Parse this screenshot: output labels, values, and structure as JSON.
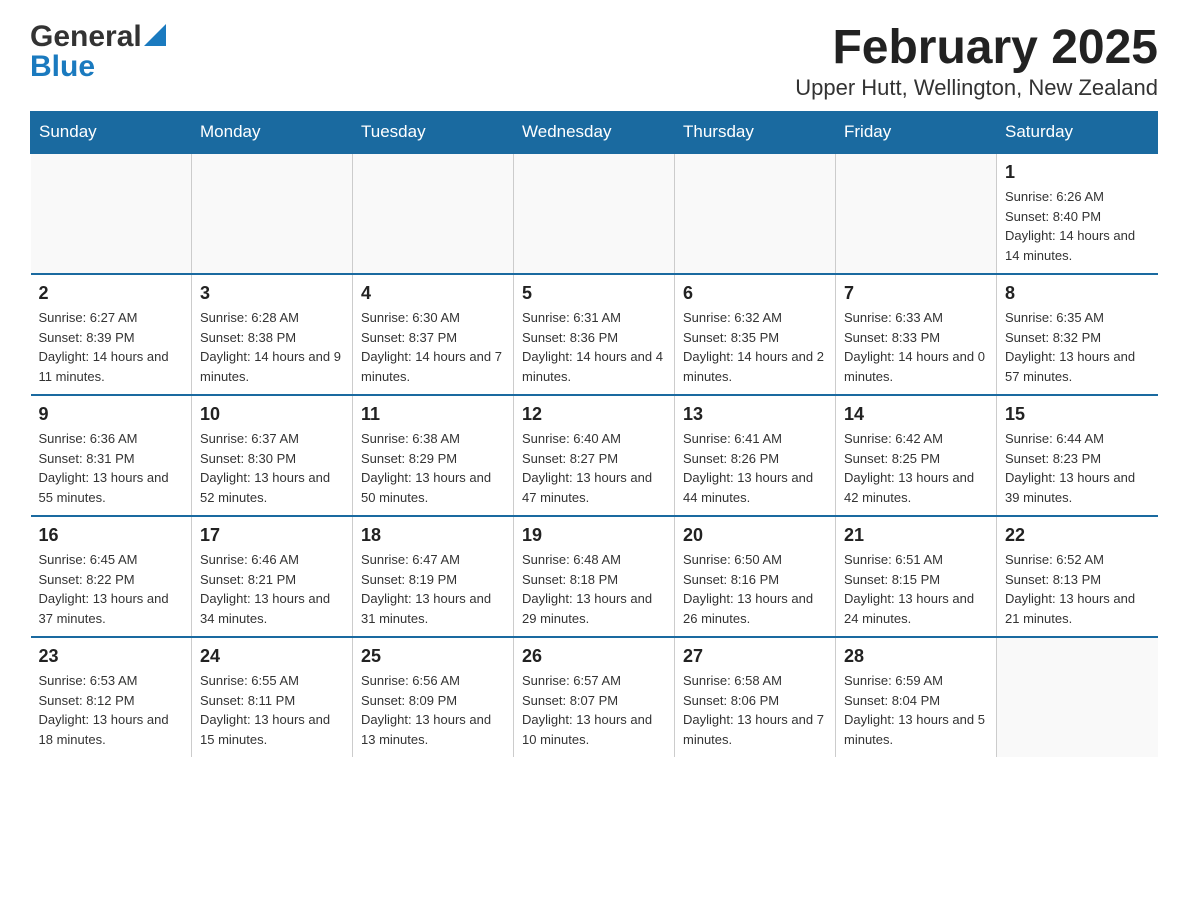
{
  "logo": {
    "general": "General",
    "blue": "Blue"
  },
  "title": "February 2025",
  "subtitle": "Upper Hutt, Wellington, New Zealand",
  "days_of_week": [
    "Sunday",
    "Monday",
    "Tuesday",
    "Wednesday",
    "Thursday",
    "Friday",
    "Saturday"
  ],
  "weeks": [
    {
      "days": [
        {
          "number": "",
          "sunrise": "",
          "sunset": "",
          "daylight": "",
          "empty": true
        },
        {
          "number": "",
          "sunrise": "",
          "sunset": "",
          "daylight": "",
          "empty": true
        },
        {
          "number": "",
          "sunrise": "",
          "sunset": "",
          "daylight": "",
          "empty": true
        },
        {
          "number": "",
          "sunrise": "",
          "sunset": "",
          "daylight": "",
          "empty": true
        },
        {
          "number": "",
          "sunrise": "",
          "sunset": "",
          "daylight": "",
          "empty": true
        },
        {
          "number": "",
          "sunrise": "",
          "sunset": "",
          "daylight": "",
          "empty": true
        },
        {
          "number": "1",
          "sunrise": "Sunrise: 6:26 AM",
          "sunset": "Sunset: 8:40 PM",
          "daylight": "Daylight: 14 hours and 14 minutes.",
          "empty": false
        }
      ]
    },
    {
      "days": [
        {
          "number": "2",
          "sunrise": "Sunrise: 6:27 AM",
          "sunset": "Sunset: 8:39 PM",
          "daylight": "Daylight: 14 hours and 11 minutes.",
          "empty": false
        },
        {
          "number": "3",
          "sunrise": "Sunrise: 6:28 AM",
          "sunset": "Sunset: 8:38 PM",
          "daylight": "Daylight: 14 hours and 9 minutes.",
          "empty": false
        },
        {
          "number": "4",
          "sunrise": "Sunrise: 6:30 AM",
          "sunset": "Sunset: 8:37 PM",
          "daylight": "Daylight: 14 hours and 7 minutes.",
          "empty": false
        },
        {
          "number": "5",
          "sunrise": "Sunrise: 6:31 AM",
          "sunset": "Sunset: 8:36 PM",
          "daylight": "Daylight: 14 hours and 4 minutes.",
          "empty": false
        },
        {
          "number": "6",
          "sunrise": "Sunrise: 6:32 AM",
          "sunset": "Sunset: 8:35 PM",
          "daylight": "Daylight: 14 hours and 2 minutes.",
          "empty": false
        },
        {
          "number": "7",
          "sunrise": "Sunrise: 6:33 AM",
          "sunset": "Sunset: 8:33 PM",
          "daylight": "Daylight: 14 hours and 0 minutes.",
          "empty": false
        },
        {
          "number": "8",
          "sunrise": "Sunrise: 6:35 AM",
          "sunset": "Sunset: 8:32 PM",
          "daylight": "Daylight: 13 hours and 57 minutes.",
          "empty": false
        }
      ]
    },
    {
      "days": [
        {
          "number": "9",
          "sunrise": "Sunrise: 6:36 AM",
          "sunset": "Sunset: 8:31 PM",
          "daylight": "Daylight: 13 hours and 55 minutes.",
          "empty": false
        },
        {
          "number": "10",
          "sunrise": "Sunrise: 6:37 AM",
          "sunset": "Sunset: 8:30 PM",
          "daylight": "Daylight: 13 hours and 52 minutes.",
          "empty": false
        },
        {
          "number": "11",
          "sunrise": "Sunrise: 6:38 AM",
          "sunset": "Sunset: 8:29 PM",
          "daylight": "Daylight: 13 hours and 50 minutes.",
          "empty": false
        },
        {
          "number": "12",
          "sunrise": "Sunrise: 6:40 AM",
          "sunset": "Sunset: 8:27 PM",
          "daylight": "Daylight: 13 hours and 47 minutes.",
          "empty": false
        },
        {
          "number": "13",
          "sunrise": "Sunrise: 6:41 AM",
          "sunset": "Sunset: 8:26 PM",
          "daylight": "Daylight: 13 hours and 44 minutes.",
          "empty": false
        },
        {
          "number": "14",
          "sunrise": "Sunrise: 6:42 AM",
          "sunset": "Sunset: 8:25 PM",
          "daylight": "Daylight: 13 hours and 42 minutes.",
          "empty": false
        },
        {
          "number": "15",
          "sunrise": "Sunrise: 6:44 AM",
          "sunset": "Sunset: 8:23 PM",
          "daylight": "Daylight: 13 hours and 39 minutes.",
          "empty": false
        }
      ]
    },
    {
      "days": [
        {
          "number": "16",
          "sunrise": "Sunrise: 6:45 AM",
          "sunset": "Sunset: 8:22 PM",
          "daylight": "Daylight: 13 hours and 37 minutes.",
          "empty": false
        },
        {
          "number": "17",
          "sunrise": "Sunrise: 6:46 AM",
          "sunset": "Sunset: 8:21 PM",
          "daylight": "Daylight: 13 hours and 34 minutes.",
          "empty": false
        },
        {
          "number": "18",
          "sunrise": "Sunrise: 6:47 AM",
          "sunset": "Sunset: 8:19 PM",
          "daylight": "Daylight: 13 hours and 31 minutes.",
          "empty": false
        },
        {
          "number": "19",
          "sunrise": "Sunrise: 6:48 AM",
          "sunset": "Sunset: 8:18 PM",
          "daylight": "Daylight: 13 hours and 29 minutes.",
          "empty": false
        },
        {
          "number": "20",
          "sunrise": "Sunrise: 6:50 AM",
          "sunset": "Sunset: 8:16 PM",
          "daylight": "Daylight: 13 hours and 26 minutes.",
          "empty": false
        },
        {
          "number": "21",
          "sunrise": "Sunrise: 6:51 AM",
          "sunset": "Sunset: 8:15 PM",
          "daylight": "Daylight: 13 hours and 24 minutes.",
          "empty": false
        },
        {
          "number": "22",
          "sunrise": "Sunrise: 6:52 AM",
          "sunset": "Sunset: 8:13 PM",
          "daylight": "Daylight: 13 hours and 21 minutes.",
          "empty": false
        }
      ]
    },
    {
      "days": [
        {
          "number": "23",
          "sunrise": "Sunrise: 6:53 AM",
          "sunset": "Sunset: 8:12 PM",
          "daylight": "Daylight: 13 hours and 18 minutes.",
          "empty": false
        },
        {
          "number": "24",
          "sunrise": "Sunrise: 6:55 AM",
          "sunset": "Sunset: 8:11 PM",
          "daylight": "Daylight: 13 hours and 15 minutes.",
          "empty": false
        },
        {
          "number": "25",
          "sunrise": "Sunrise: 6:56 AM",
          "sunset": "Sunset: 8:09 PM",
          "daylight": "Daylight: 13 hours and 13 minutes.",
          "empty": false
        },
        {
          "number": "26",
          "sunrise": "Sunrise: 6:57 AM",
          "sunset": "Sunset: 8:07 PM",
          "daylight": "Daylight: 13 hours and 10 minutes.",
          "empty": false
        },
        {
          "number": "27",
          "sunrise": "Sunrise: 6:58 AM",
          "sunset": "Sunset: 8:06 PM",
          "daylight": "Daylight: 13 hours and 7 minutes.",
          "empty": false
        },
        {
          "number": "28",
          "sunrise": "Sunrise: 6:59 AM",
          "sunset": "Sunset: 8:04 PM",
          "daylight": "Daylight: 13 hours and 5 minutes.",
          "empty": false
        },
        {
          "number": "",
          "sunrise": "",
          "sunset": "",
          "daylight": "",
          "empty": true
        }
      ]
    }
  ]
}
